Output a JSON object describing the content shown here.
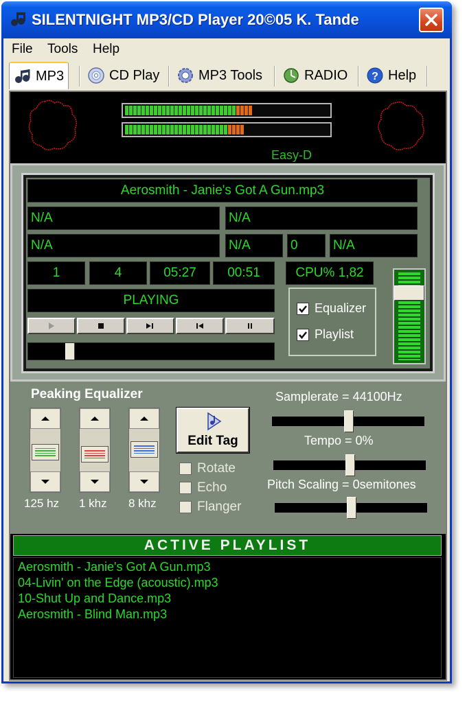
{
  "window": {
    "title": "SILENTNIGHT MP3/CD Player 20©05 K. Tande"
  },
  "menu": [
    "File",
    "Tools",
    "Help"
  ],
  "tabs": [
    {
      "label": "MP3",
      "icon": "music-notes-icon"
    },
    {
      "label": "CD Play",
      "icon": "cd-disc-icon"
    },
    {
      "label": "MP3 Tools",
      "icon": "gear-icon"
    },
    {
      "label": "RADIO",
      "icon": "radio-globe-icon"
    },
    {
      "label": "Help",
      "icon": "question-icon"
    }
  ],
  "visualizer": {
    "vu_meter_top_level": 0.65,
    "vu_meter_bottom_level": 0.6,
    "label": "Easy-D"
  },
  "player": {
    "track_title": "Aerosmith - Janie's Got A Gun.mp3",
    "info_1": "N/A",
    "info_2": "N/A",
    "info_3": "N/A",
    "info_4": "N/A",
    "info_5": "0",
    "info_6": "N/A",
    "track_number": "1",
    "track_count": "4",
    "total_time": "05:27",
    "elapsed_time": "00:51",
    "cpu": "CPU% 1,82",
    "status": "PLAYING",
    "controls": {
      "play": "play-icon",
      "stop": "stop-icon",
      "next": "next-track-icon",
      "prev": "prev-track-icon",
      "pause": "pause-icon"
    },
    "seek_position": 0.16,
    "volume_level": 0.8,
    "equalizer_checkbox": {
      "label": "Equalizer",
      "checked": true
    },
    "playlist_checkbox": {
      "label": "Playlist",
      "checked": true
    }
  },
  "equalizer": {
    "title": "Peaking Equalizer",
    "bands": [
      {
        "label": "125 hz",
        "level": 0.45,
        "color": "#3fae3a"
      },
      {
        "label": "1 khz",
        "level": 0.35,
        "color": "#e0403c"
      },
      {
        "label": "8 khz",
        "level": 0.55,
        "color": "#3c6ee0"
      }
    ],
    "edit_tag_label": "Edit Tag",
    "effects": [
      {
        "label": "Rotate",
        "checked": false
      },
      {
        "label": "Echo",
        "checked": false
      },
      {
        "label": "Flanger",
        "checked": false
      }
    ],
    "samplerate_label": "Samplerate = 44100Hz",
    "samplerate_position": 0.5,
    "tempo_label": "Tempo = 0%",
    "tempo_position": 0.5,
    "pitch_label": "Pitch Scaling = 0semitones",
    "pitch_position": 0.5
  },
  "playlist": {
    "header": "ACTIVE PLAYLIST",
    "items": [
      "Aerosmith - Janie's Got A Gun.mp3",
      "04-Livin' on the Edge (acoustic).mp3",
      "10-Shut Up and Dance.mp3",
      "Aerosmith - Blind Man.mp3"
    ]
  },
  "colors": {
    "lcd_text": "#2bd92b",
    "titlebar": "#0a4fd8",
    "panel": "#7d8a79"
  }
}
